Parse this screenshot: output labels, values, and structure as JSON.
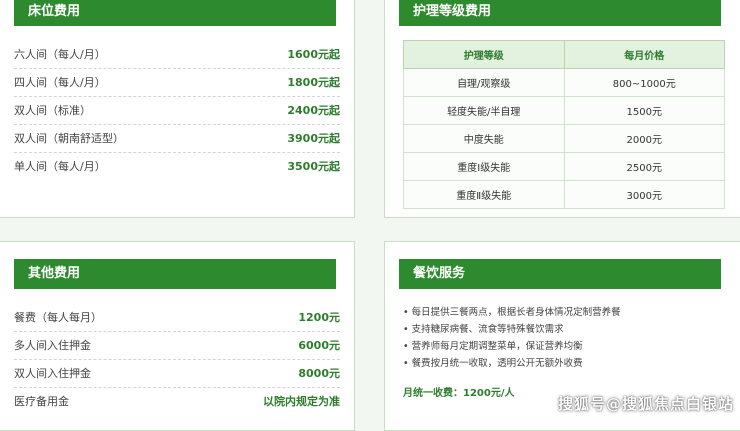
{
  "bed": {
    "title": "床位费用",
    "rows": [
      {
        "label": "六人间（每人/月）",
        "value": "1600元起"
      },
      {
        "label": "四人间（每人/月）",
        "value": "1800元起"
      },
      {
        "label": "双人间（标准）",
        "value": "2400元起"
      },
      {
        "label": "双人间（朝南舒适型）",
        "value": "3900元起"
      },
      {
        "label": "单人间（每人/月）",
        "value": "3500元起"
      }
    ]
  },
  "care": {
    "title": "护理等级费用",
    "headers": [
      "护理等级",
      "每月价格"
    ],
    "rows": [
      [
        "自理/观察级",
        "800~1000元"
      ],
      [
        "轻度失能/半自理",
        "1500元"
      ],
      [
        "中度失能",
        "2000元"
      ],
      [
        "重度Ⅰ级失能",
        "2500元"
      ],
      [
        "重度Ⅱ级失能",
        "3000元"
      ]
    ]
  },
  "other": {
    "title": "其他费用",
    "rows": [
      {
        "label": "餐费（每人每月）",
        "value": "1200元"
      },
      {
        "label": "多人间入住押金",
        "value": "6000元"
      },
      {
        "label": "双人间入住押金",
        "value": "8000元"
      },
      {
        "label": "医疗备用金",
        "value": "以院内规定为准"
      }
    ]
  },
  "dining": {
    "title": "餐饮服务",
    "items": [
      "每日提供三餐两点，根据长者身体情况定制营养餐",
      "支持糖尿病餐、流食等特殊餐饮需求",
      "营养师每月定期调整菜单，保证营养均衡",
      "餐费按月统一收取，透明公开无额外收费"
    ],
    "monthly": "月统一收费：1200元/人"
  },
  "watermark": "搜狐号@搜狐焦点白银站"
}
